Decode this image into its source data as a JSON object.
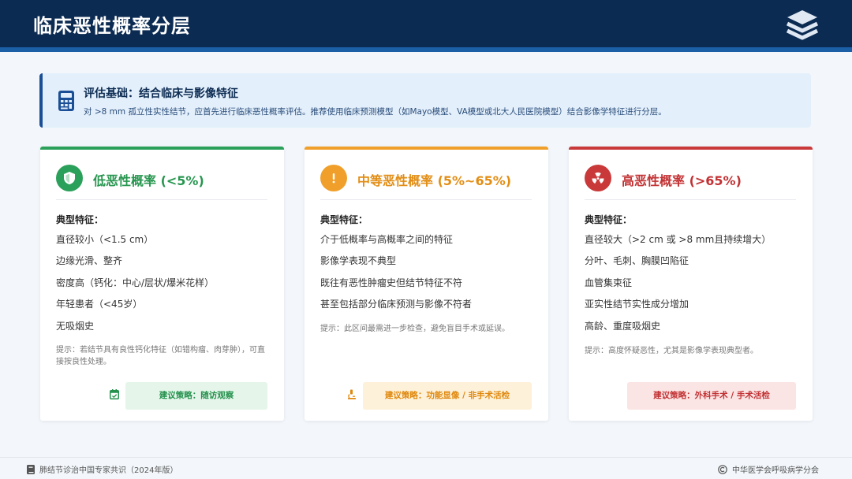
{
  "header": {
    "title": "临床恶性概率分层",
    "icon": "layers-icon"
  },
  "info": {
    "icon": "calculator-icon",
    "title": "评估基础：结合临床与影像特征",
    "text": "对 >8 mm 孤立性实性结节，应首先进行临床恶性概率评估。推荐使用临床预测模型（如Mayo模型、VA模型或北大人民医院模型）结合影像学特征进行分层。"
  },
  "cards": [
    {
      "icon": "shield-icon",
      "color": "#2aa05a",
      "title": "低恶性概率 (<5%)",
      "features_heading": "典型特征：",
      "features": [
        "直径较小（<1.5 cm）",
        "边缘光滑、整齐",
        "密度高（钙化：中心/层状/爆米花样）",
        "年轻患者（<45岁）",
        "无吸烟史"
      ],
      "tip": "提示：若结节具有良性钙化特征（如错构瘤、肉芽肿），可直接按良性处理。",
      "strategy_icon": "calendar-check-icon",
      "strategy": "建议策略：随访观察"
    },
    {
      "icon": "exclamation-icon",
      "color": "#f0a02a",
      "title": "中等恶性概率 (5%~65%)",
      "features_heading": "典型特征：",
      "features": [
        "介于低概率与高概率之间的特征",
        "影像学表现不典型",
        "既往有恶性肿瘤史但结节特征不符",
        "甚至包括部分临床预测与影像不符者"
      ],
      "tip": "提示：此区间最需进一步检查，避免盲目手术或延误。",
      "strategy_icon": "microscope-icon",
      "strategy": "建议策略：功能显像 / 非手术活检"
    },
    {
      "icon": "radiation-icon",
      "color": "#c9393a",
      "title": "高恶性概率 (>65%)",
      "features_heading": "典型特征：",
      "features": [
        "直径较大（>2 cm 或 >8 mm且持续增大）",
        "分叶、毛刺、胸膜凹陷征",
        "血管集束征",
        "亚实性结节实性成分增加",
        "高龄、重度吸烟史"
      ],
      "tip": "提示：高度怀疑恶性，尤其是影像学表现典型者。",
      "strategy": "建议策略：外科手术 / 手术活检"
    }
  ],
  "footer": {
    "left_icon": "book-icon",
    "left": "肺结节诊治中国专家共识（2024年版）",
    "right_icon": "copyright-icon",
    "right": "中华医学会呼吸病学分会"
  }
}
